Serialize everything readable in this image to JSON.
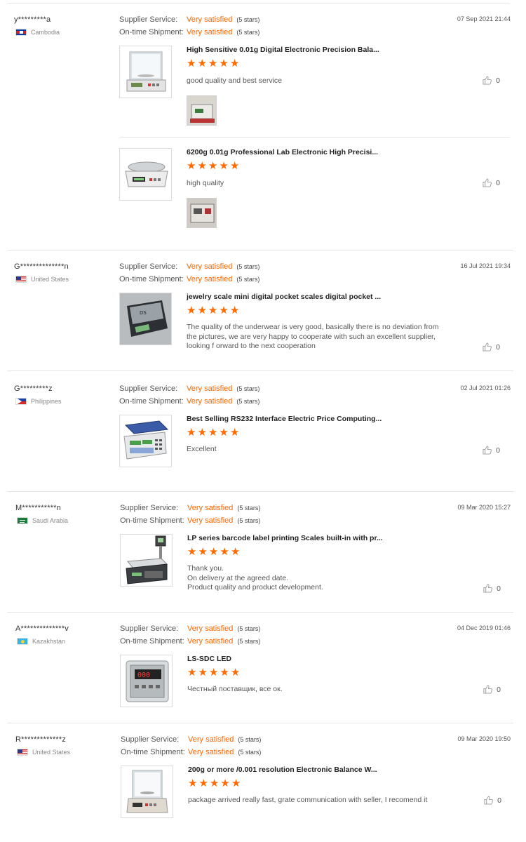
{
  "labels": {
    "supplier_service": "Supplier Service:",
    "ontime_shipment": "On-time Shipment:"
  },
  "colors": {
    "accent": "#ff6600",
    "star": "#ff6a00"
  },
  "reviews": [
    {
      "buyer": "y*********a",
      "country": "Cambodia",
      "date": "07 Sep 2021 21:44",
      "supplier_rating": "Very satisfied",
      "supplier_stars": "(5 stars)",
      "shipment_rating": "Very satisfied",
      "shipment_stars": "(5 stars)",
      "items": [
        {
          "title": "High Sensitive 0.01g Digital Electronic Precision Bala...",
          "rating": 5,
          "text": "good quality and best service",
          "likes": "0",
          "product_icon": "precision-balance-image"
        },
        {
          "title": "6200g 0.01g Professional Lab Electronic High Precisi...",
          "rating": 5,
          "text": "high quality",
          "likes": "0",
          "product_icon": "lab-scale-image"
        }
      ]
    },
    {
      "buyer": "G**************n",
      "country": "United States",
      "date": "16 Jul 2021 19:34",
      "supplier_rating": "Very satisfied",
      "supplier_stars": "(5 stars)",
      "shipment_rating": "Very satisfied",
      "shipment_stars": "(5 stars)",
      "items": [
        {
          "title": "jewelry scale mini digital pocket scales digital pocket ...",
          "rating": 5,
          "text": "The quality of the underwear is very good, basically there is no deviation from the pictures, we are very happy to cooperate with such an excellent supplier, looking f orward to the next cooperation",
          "likes": "0",
          "product_icon": "pocket-scale-image"
        }
      ]
    },
    {
      "buyer": "G*********z",
      "country": "Philippines",
      "date": "02 Jul 2021 01:26",
      "supplier_rating": "Very satisfied",
      "supplier_stars": "(5 stars)",
      "shipment_rating": "Very satisfied",
      "shipment_stars": "(5 stars)",
      "items": [
        {
          "title": "Best Selling RS232 Interface Electric Price Computing...",
          "rating": 5,
          "text": "Excellent",
          "likes": "0",
          "product_icon": "price-computing-scale-image"
        }
      ]
    },
    {
      "buyer": "M***********n",
      "country": "Saudi Arabia",
      "date": "09 Mar 2020 15:27",
      "supplier_rating": "Very satisfied",
      "supplier_stars": "(5 stars)",
      "shipment_rating": "Very satisfied",
      "shipment_stars": "(5 stars)",
      "items": [
        {
          "title": "LP series barcode label printing Scales built-in with pr...",
          "rating": 5,
          "text": "Thank you.\nOn delivery at the agreed date.\nProduct quality and product development.",
          "likes": "0",
          "product_icon": "label-printing-scale-image"
        }
      ]
    },
    {
      "buyer": "A**************v",
      "country": "Kazakhstan",
      "date": "04 Dec 2019 01:46",
      "supplier_rating": "Very satisfied",
      "supplier_stars": "(5 stars)",
      "shipment_rating": "Very satisfied",
      "shipment_stars": "(5 stars)",
      "items": [
        {
          "title": "LS-SDC LED",
          "rating": 5,
          "text": "Честный поставщик, все ок.",
          "likes": "0",
          "product_icon": "led-indicator-image"
        }
      ]
    },
    {
      "buyer": "R*************z",
      "country": "United States",
      "date": "09 Mar 2020 19:50",
      "supplier_rating": "Very satisfied",
      "supplier_stars": "(5 stars)",
      "shipment_rating": "Very satisfied",
      "shipment_stars": "(5 stars)",
      "items": [
        {
          "title": "200g or more /0.001 resolution Electronic Balance W...",
          "rating": 5,
          "text": "package arrived really fast, grate communication with seller, I recomend it",
          "likes": "0",
          "product_icon": "electronic-balance-image"
        }
      ]
    }
  ]
}
